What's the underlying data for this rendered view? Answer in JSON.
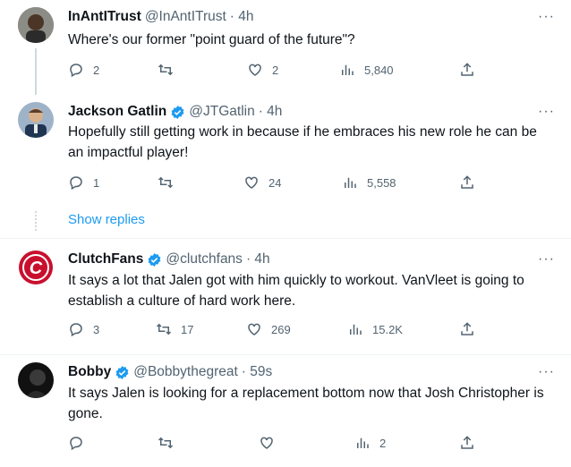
{
  "tweets": [
    {
      "name": "InAntITrust",
      "handle": "@InAntITrust",
      "time": "· 4h",
      "verified": false,
      "text": "Where's our former \"point guard of the future\"?",
      "replies": "2",
      "retweets": "",
      "likes": "2",
      "views": "5,840"
    },
    {
      "name": "Jackson Gatlin",
      "handle": "@JTGatlin",
      "time": "· 4h",
      "verified": true,
      "text": "Hopefully still getting work in because if he embraces his new role he can be an impactful player!",
      "replies": "1",
      "retweets": "",
      "likes": "24",
      "views": "5,558"
    },
    {
      "name": "ClutchFans",
      "handle": "@clutchfans",
      "time": "· 4h",
      "verified": true,
      "text": "It says a lot that Jalen got with him quickly to workout. VanVleet is going to establish a culture of hard work here.",
      "replies": "3",
      "retweets": "17",
      "likes": "269",
      "views": "15.2K"
    },
    {
      "name": "Bobby",
      "handle": "@Bobbythegreat",
      "time": "· 59s",
      "verified": true,
      "text": "It says Jalen is looking for a replacement bottom now that Josh Christopher is gone.",
      "replies": "",
      "retweets": "",
      "likes": "",
      "views": "2"
    }
  ],
  "show_replies": "Show replies",
  "colors": {
    "text": "#0f1419",
    "secondary": "#536471",
    "accent": "#1d9bf0",
    "clutchfans_red": "#c8102e"
  }
}
